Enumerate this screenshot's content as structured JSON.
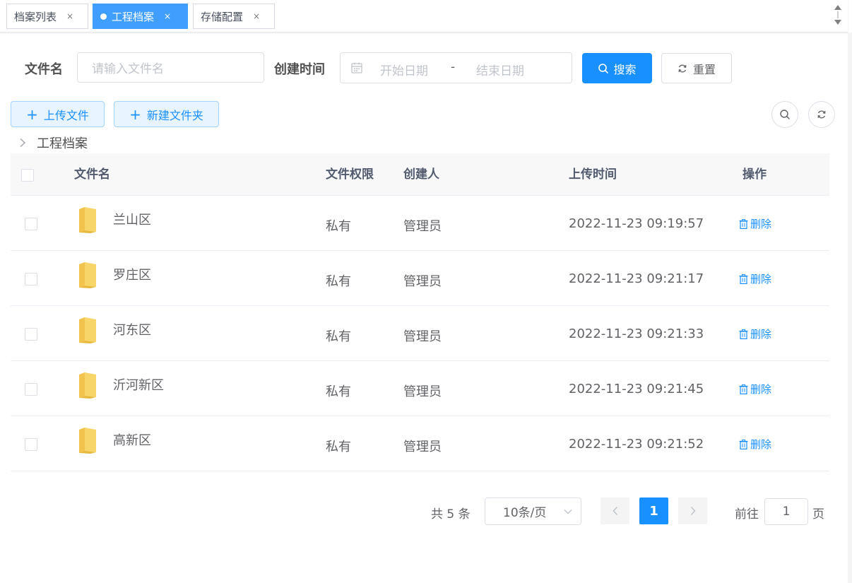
{
  "tabs": [
    {
      "label": "档案列表",
      "close": "×",
      "active": false
    },
    {
      "label": "工程档案",
      "close": "×",
      "active": true
    },
    {
      "label": "存储配置",
      "close": "×",
      "active": false
    }
  ],
  "search": {
    "file_name_label": "文件名",
    "file_name_placeholder": "请输入文件名",
    "created_time_label": "创建时间",
    "start_date_placeholder": "开始日期",
    "range_separator": "-",
    "end_date_placeholder": "结束日期",
    "search_button": "搜索",
    "reset_button": "重置"
  },
  "toolbar": {
    "upload_button": "上传文件",
    "new_folder_button": "新建文件夹"
  },
  "breadcrumb": {
    "current": "工程档案"
  },
  "table": {
    "columns": {
      "name": "文件名",
      "permission": "文件权限",
      "creator": "创建人",
      "upload_time": "上传时间",
      "actions": "操作"
    },
    "rows": [
      {
        "name": "兰山区",
        "permission": "私有",
        "creator": "管理员",
        "upload_time": "2022-11-23 09:19:57",
        "action": "删除"
      },
      {
        "name": "罗庄区",
        "permission": "私有",
        "creator": "管理员",
        "upload_time": "2022-11-23 09:21:17",
        "action": "删除"
      },
      {
        "name": "河东区",
        "permission": "私有",
        "creator": "管理员",
        "upload_time": "2022-11-23 09:21:33",
        "action": "删除"
      },
      {
        "name": "沂河新区",
        "permission": "私有",
        "creator": "管理员",
        "upload_time": "2022-11-23 09:21:45",
        "action": "删除"
      },
      {
        "name": "高新区",
        "permission": "私有",
        "creator": "管理员",
        "upload_time": "2022-11-23 09:21:52",
        "action": "删除"
      }
    ]
  },
  "pagination": {
    "total_text": "共 5 条",
    "page_size": "10条/页",
    "current_page": "1",
    "goto_prefix": "前往",
    "goto_value": "1",
    "goto_suffix": "页"
  },
  "colors": {
    "primary": "#1890ff",
    "tab_active": "#409eff",
    "folder": "#f8d568"
  }
}
